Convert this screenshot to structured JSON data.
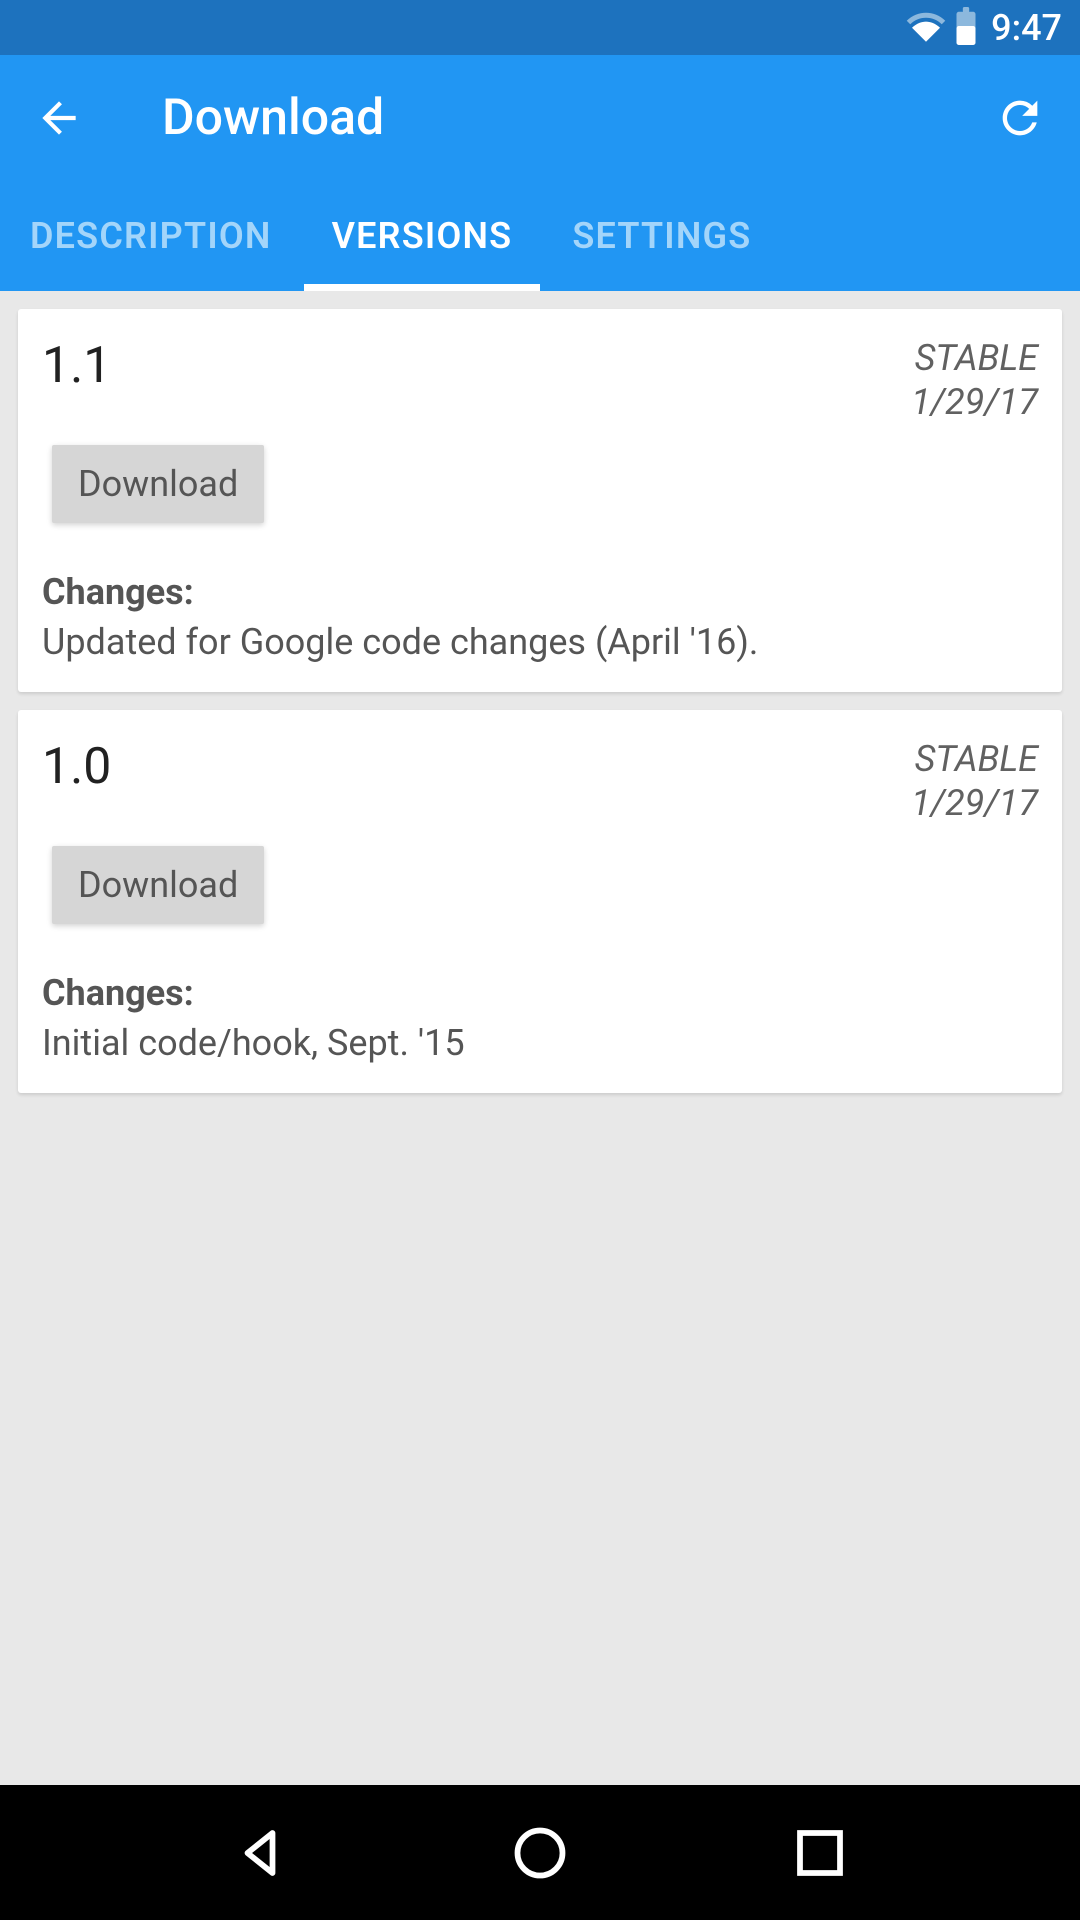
{
  "status_bar": {
    "time": "9:47"
  },
  "toolbar": {
    "title": "Download"
  },
  "tabs": {
    "description": "DESCRIPTION",
    "versions": "VERSIONS",
    "settings": "SETTINGS"
  },
  "versions": [
    {
      "number": "1.1",
      "stability": "STABLE",
      "date": "1/29/17",
      "download_label": "Download",
      "changes_label": "Changes:",
      "changes_text": "Updated for Google code changes (April '16)."
    },
    {
      "number": "1.0",
      "stability": "STABLE",
      "date": "1/29/17",
      "download_label": "Download",
      "changes_label": "Changes:",
      "changes_text": "Initial code/hook, Sept. '15"
    }
  ]
}
